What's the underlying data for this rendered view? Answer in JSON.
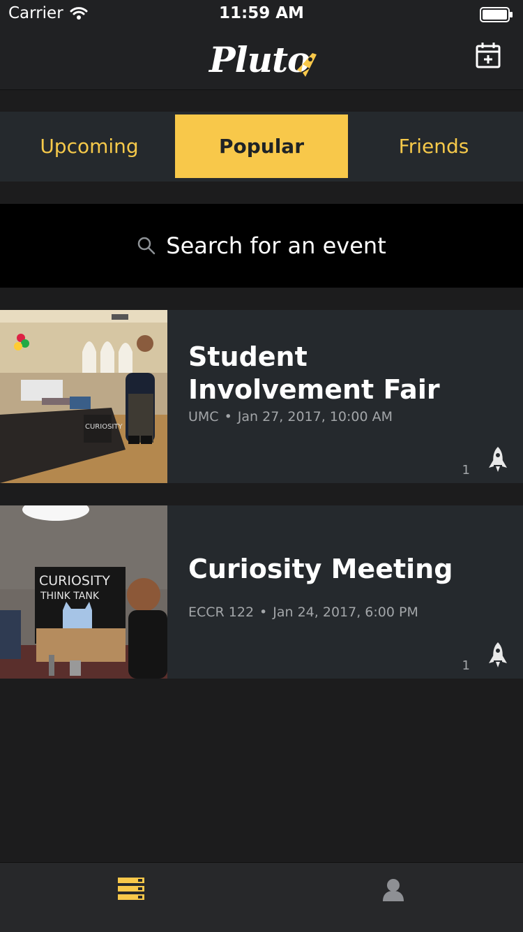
{
  "status": {
    "carrier": "Carrier",
    "time": "11:59 AM"
  },
  "app": {
    "logo_text": "Pluto"
  },
  "tabs": [
    "Upcoming",
    "Popular",
    "Friends"
  ],
  "active_tab": "Popular",
  "search": {
    "placeholder": "Search for an event"
  },
  "events": [
    {
      "title": "Student Involvement Fair",
      "location": "UMC",
      "datetime": "Jan 27, 2017, 10:00 AM",
      "rocket_count": "1"
    },
    {
      "title": "Curiosity Meeting",
      "location": "ECCR 122",
      "datetime": "Jan 24, 2017, 6:00 PM",
      "rocket_count": "1"
    }
  ],
  "colors": {
    "accent": "#f8c84a",
    "background": "#1c1c1d",
    "card": "#25292d",
    "bar": "#202123"
  },
  "icons": [
    "wifi-icon",
    "battery-icon",
    "calendar-add-icon",
    "search-icon",
    "rocket-icon",
    "event-list-icon",
    "profile-icon"
  ]
}
